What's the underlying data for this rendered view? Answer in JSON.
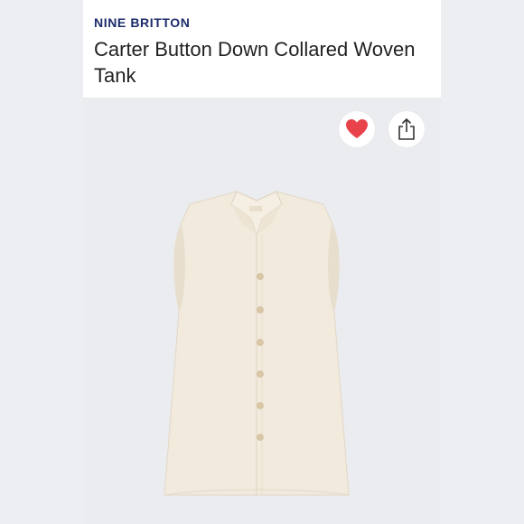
{
  "product": {
    "brand": "NINE BRITTON",
    "title": "Carter Button Down Collared Woven Tank"
  },
  "actions": {
    "like_icon": "heart-icon",
    "share_icon": "share-icon",
    "like_color": "#e8434b"
  },
  "image": {
    "subject": "sleeveless-collared-button-down-tank",
    "garment_color": "#f1eadd"
  }
}
